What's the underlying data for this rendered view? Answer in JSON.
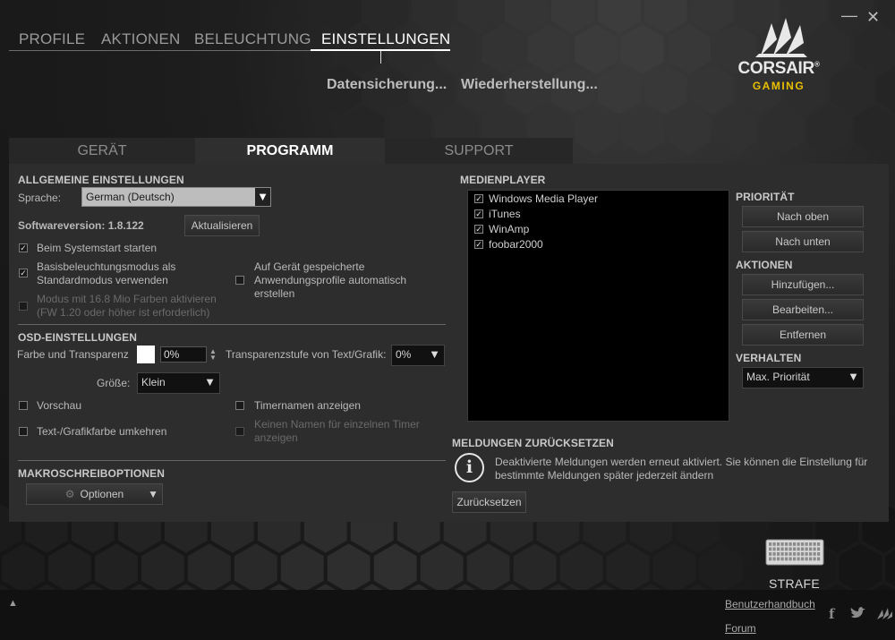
{
  "window": {
    "minimize_label": "—",
    "close_label": "✕"
  },
  "nav": {
    "tabs": [
      {
        "label": "PROFILE"
      },
      {
        "label": "AKTIONEN"
      },
      {
        "label": "BELEUCHTUNG"
      },
      {
        "label": "EINSTELLUNGEN",
        "active": true
      }
    ],
    "sub": [
      "Datensicherung...",
      "Wiederherstellung..."
    ]
  },
  "brand": {
    "name": "CORSAIR",
    "reg": "®",
    "sub": "GAMING",
    "accent": "#e8c000"
  },
  "tabs": [
    {
      "label": "GERÄT"
    },
    {
      "label": "PROGRAMM",
      "active": true
    },
    {
      "label": "SUPPORT"
    }
  ],
  "general": {
    "heading": "ALLGEMEINE EINSTELLUNGEN",
    "language_label": "Sprache:",
    "language_value": "German (Deutsch)",
    "version_label": "Softwareversion: 1.8.122",
    "update_button": "Aktualisieren",
    "options": [
      {
        "label": "Beim Systemstart starten",
        "checked": true
      },
      {
        "label": "Basisbeleuchtungsmodus als Standardmodus verwenden",
        "checked": true
      },
      {
        "label": "Modus mit 16.8 Mio Farben aktivieren (FW 1.20 oder höher ist erforderlich)",
        "checked": false,
        "disabled": true
      },
      {
        "label": "Auf Gerät gespeicherte Anwendungsprofile automatisch erstellen",
        "checked": false
      }
    ]
  },
  "osd": {
    "heading": "OSD-EINSTELLUNGEN",
    "color_label": "Farbe und Transparenz",
    "color_value": "#ffffff",
    "transparency_value": "0%",
    "text_transparency_label": "Transparenzstufe von Text/Grafik:",
    "text_transparency_value": "0%",
    "size_label": "Größe:",
    "size_value": "Klein",
    "options": [
      {
        "label": "Vorschau",
        "checked": false
      },
      {
        "label": "Timernamen anzeigen",
        "checked": false
      },
      {
        "label": "Text-/Grafikfarbe umkehren",
        "checked": false
      },
      {
        "label": "Keinen Namen für einzelnen Timer anzeigen",
        "checked": false,
        "disabled": true
      }
    ]
  },
  "macro": {
    "heading": "MAKROSCHREIBOPTIONEN",
    "options_button": "Optionen"
  },
  "media": {
    "heading": "MEDIENPLAYER",
    "players": [
      {
        "label": "Windows Media Player",
        "checked": true
      },
      {
        "label": "iTunes",
        "checked": true
      },
      {
        "label": "WinAmp",
        "checked": true
      },
      {
        "label": "foobar2000",
        "checked": true
      }
    ],
    "priority_heading": "PRIORITÄT",
    "up_button": "Nach oben",
    "down_button": "Nach unten",
    "actions_heading": "AKTIONEN",
    "add_button": "Hinzufügen...",
    "edit_button": "Bearbeiten...",
    "remove_button": "Entfernen",
    "behavior_heading": "VERHALTEN",
    "behavior_value": "Max. Priorität"
  },
  "reset": {
    "heading": "MELDUNGEN ZURÜCKSETZEN",
    "info_icon": "i",
    "text": "Deaktivierte Meldungen werden erneut aktiviert. Sie können die Einstellung für bestimmte Meldungen später jederzeit ändern",
    "button": "Zurücksetzen"
  },
  "device": {
    "name": "STRAFE"
  },
  "footer": {
    "expand_icon": "▲",
    "manual_link": "Benutzerhandbuch",
    "forum_link": "Forum",
    "facebook": "f",
    "twitter": "t"
  }
}
